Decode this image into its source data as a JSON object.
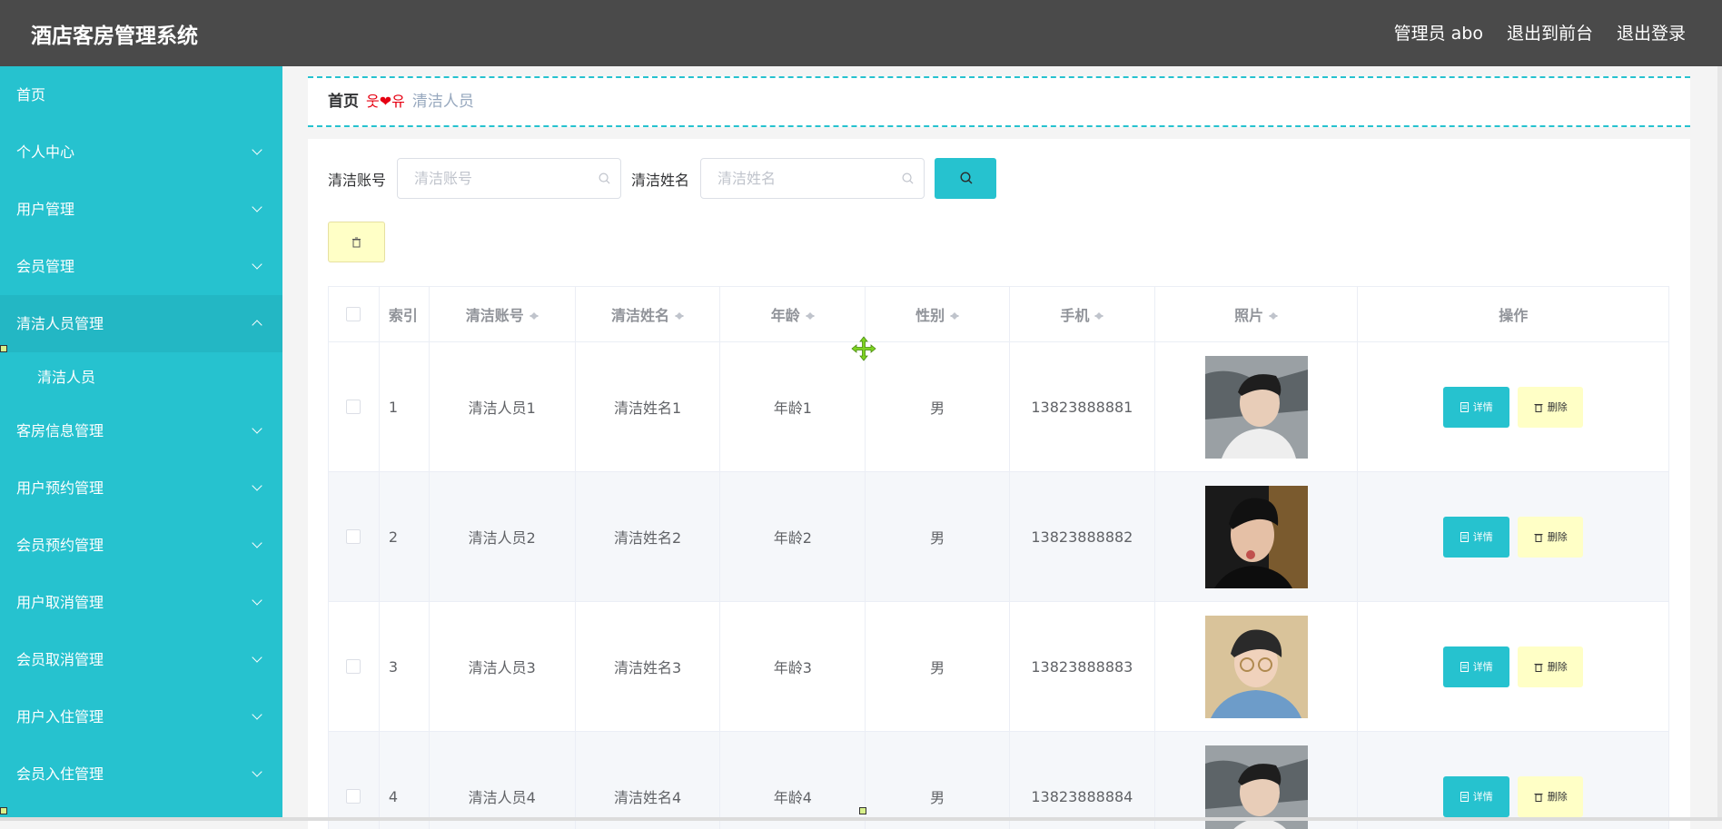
{
  "app": {
    "title": "酒店客房管理系统"
  },
  "topnav": {
    "admin": "管理员 abo",
    "to_front": "退出到前台",
    "logout": "退出登录"
  },
  "sidebar": {
    "items": [
      {
        "label": "首页"
      },
      {
        "label": "个人中心"
      },
      {
        "label": "用户管理"
      },
      {
        "label": "会员管理"
      },
      {
        "label": "清洁人员管理"
      },
      {
        "label": "客房信息管理"
      },
      {
        "label": "用户预约管理"
      },
      {
        "label": "会员预约管理"
      },
      {
        "label": "用户取消管理"
      },
      {
        "label": "会员取消管理"
      },
      {
        "label": "用户入住管理"
      },
      {
        "label": "会员入住管理"
      }
    ],
    "sub_items": [
      {
        "label": "清洁人员"
      }
    ]
  },
  "breadcrumb": {
    "home": "首页",
    "separator": "웃❤유",
    "current": "清洁人员"
  },
  "search": {
    "account_label": "清洁账号",
    "account_placeholder": "清洁账号",
    "name_label": "清洁姓名",
    "name_placeholder": "清洁姓名"
  },
  "table": {
    "headers": [
      "索引",
      "清洁账号",
      "清洁姓名",
      "年龄",
      "性别",
      "手机",
      "照片",
      "操作"
    ],
    "rows": [
      {
        "index": "1",
        "account": "清洁人员1",
        "name": "清洁姓名1",
        "age": "年龄1",
        "gender": "男",
        "phone": "13823888881"
      },
      {
        "index": "2",
        "account": "清洁人员2",
        "name": "清洁姓名2",
        "age": "年龄2",
        "gender": "男",
        "phone": "13823888882"
      },
      {
        "index": "3",
        "account": "清洁人员3",
        "name": "清洁姓名3",
        "age": "年龄3",
        "gender": "男",
        "phone": "13823888883"
      },
      {
        "index": "4",
        "account": "清洁人员4",
        "name": "清洁姓名4",
        "age": "年龄4",
        "gender": "男",
        "phone": "13823888884"
      }
    ],
    "detail_label": "详情",
    "delete_label": "删除"
  },
  "colors": {
    "accent": "#26c2cf",
    "topbar": "#4a4a4a",
    "delete_bg": "#ffffc6",
    "separator": "#e60012"
  }
}
